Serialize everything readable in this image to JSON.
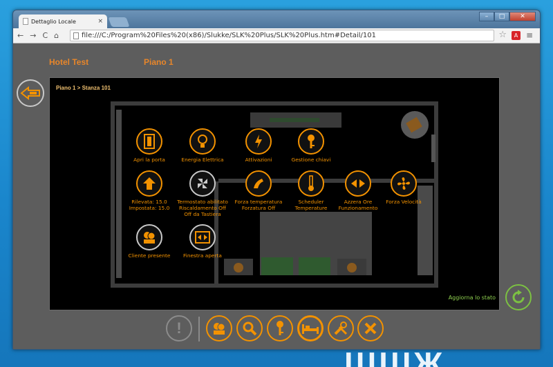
{
  "browser": {
    "tab_title": "Dettaglio Locale",
    "tab_close": "×",
    "url": "file:///C:/Program%20Files%20(x86)/Slukke/SLK%20Plus/SLK%20Plus.htm#Detail/101",
    "nav": [
      "←",
      "→",
      "C",
      "⌂"
    ]
  },
  "header": {
    "hotel": "Hotel Test",
    "floor": "Piano 1"
  },
  "breadcrumb": {
    "text": "Piano 1  >  Stanza 101"
  },
  "controls": [
    {
      "id": "apri",
      "label": "Apri la porta",
      "icon": "door-icon"
    },
    {
      "id": "energia",
      "label": "Energia Elettrica",
      "icon": "bulb-icon"
    },
    {
      "id": "attivazioni",
      "label": "Attivazioni",
      "icon": "lightning-icon"
    },
    {
      "id": "chiavi",
      "label": "Gestione chiavi",
      "icon": "key-icon"
    },
    {
      "id": "temp",
      "label": "Rilevata: 15.0\nImpostata: 15.0",
      "icon": "arrow-up-icon"
    },
    {
      "id": "termostato",
      "label": "Termostato abilitato\nRiscaldamento Off\nOff da Tastiera",
      "icon": "fan-gray-icon"
    },
    {
      "id": "forzatemp",
      "label": "Forza temperatura\nForzatura Off",
      "icon": "hand-icon"
    },
    {
      "id": "scheduler",
      "label": "Scheduler\nTemperature",
      "icon": "thermometer-icon"
    },
    {
      "id": "azzera",
      "label": "Azzera Ore\nFunzionamento",
      "icon": "reset-icon"
    },
    {
      "id": "velocita",
      "label": "Forza Velocità",
      "icon": "fan-icon"
    },
    {
      "id": "cliente",
      "label": "Cliente presente",
      "icon": "people-icon"
    },
    {
      "id": "finestra",
      "label": "Finestra aperta",
      "icon": "window-icon"
    }
  ],
  "refresh": {
    "label": "Aggiorna lo stato"
  },
  "bottom_bar": [
    "alert-icon",
    "people-icon",
    "search-icon",
    "key-icon",
    "bed-icon",
    "tools-icon",
    "close-icon"
  ],
  "colors": {
    "accent": "#f39200",
    "refresh": "#7cc142",
    "panel": "#000000",
    "background": "#5d5d5d"
  }
}
